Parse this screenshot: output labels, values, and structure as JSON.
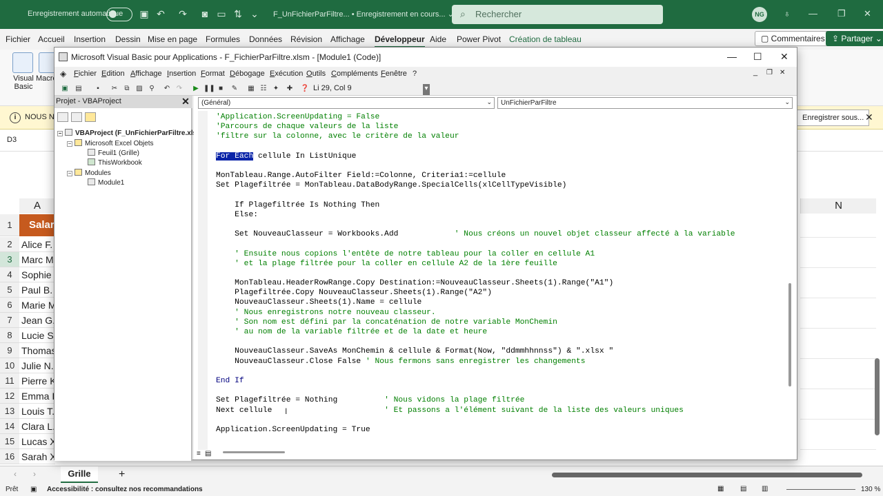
{
  "excel": {
    "autosave_label": "Enregistrement automatique",
    "doc_title": "F_UnFichierParFiltre... • Enregistrement en cours... ⌄",
    "search_placeholder": "Rechercher",
    "avatar_initials": "NG",
    "tabs": [
      "Fichier",
      "Accueil",
      "Insertion",
      "Dessin",
      "Mise en page",
      "Formules",
      "Données",
      "Révision",
      "Affichage",
      "Développeur",
      "Aide",
      "Power Pivot",
      "Création de tableau"
    ],
    "comments_label": "Commentaires",
    "share_label": "Partager",
    "ribbon_visual_basic": "Visual\nBasic",
    "ribbon_macro": "Macro",
    "info_text": "NOUS NE",
    "info_button": "Enregistrer sous...",
    "namebox": "D3",
    "col_a": "A",
    "col_n": "N",
    "header_salary": "Salar",
    "rows": [
      {
        "num": "2",
        "a": "Alice F."
      },
      {
        "num": "3",
        "a": "Marc M"
      },
      {
        "num": "4",
        "a": "Sophie"
      },
      {
        "num": "5",
        "a": "Paul B."
      },
      {
        "num": "6",
        "a": "Marie M"
      },
      {
        "num": "7",
        "a": "Jean G."
      },
      {
        "num": "8",
        "a": "Lucie S."
      },
      {
        "num": "9",
        "a": "Thomas"
      },
      {
        "num": "10",
        "a": "Julie N."
      },
      {
        "num": "11",
        "a": "Pierre K"
      },
      {
        "num": "12",
        "a": "Emma I"
      },
      {
        "num": "13",
        "a": "Louis T."
      },
      {
        "num": "14",
        "a": "Clara L."
      },
      {
        "num": "15",
        "a": "Lucas X"
      },
      {
        "num": "16",
        "a": "Sarah X."
      }
    ],
    "sheet_tab": "Grille",
    "status_ready": "Prêt",
    "status_access": "Accessibilité : consultez nos recommandations",
    "zoom": "130 %"
  },
  "vbe": {
    "title": "Microsoft Visual Basic pour Applications - F_FichierParFiltre.xlsm - [Module1 (Code)]",
    "menu": [
      "Fichier",
      "Edition",
      "Affichage",
      "Insertion",
      "Format",
      "Débogage",
      "Exécution",
      "Outils",
      "Compléments",
      "Fenêtre",
      "?"
    ],
    "cursor_position": "Li 29, Col 9",
    "project_title": "Projet - VBAProject",
    "tree": {
      "root": "VBAProject (F_UnFichierParFiltre.xlsx)",
      "excel_objects": "Microsoft Excel Objets",
      "sheet1": "Feuil1 (Grille)",
      "thisworkbook": "ThisWorkbook",
      "modules": "Modules",
      "module1": "Module1"
    },
    "combo_left": "(Général)",
    "combo_right": "UnFichierParFiltre",
    "code": {
      "l1": "'Application.ScreenUpdating = False",
      "l2": "'Parcours de chaque valeurs de la liste",
      "l3": "'filtre sur la colonne, avec le critère de la valeur",
      "l4_kw": "For Each",
      "l4_rest": " cellule In ListUnique",
      "l5": "MonTableau.Range.AutoFilter Field:=Colonne, Criteria1:=cellule",
      "l6": "Set Plagefiltrée = MonTableau.DataBodyRange.SpecialCells(xlCellTypeVisible)",
      "l7": "    If Plagefiltrée Is Nothing Then",
      "l8": "    Else:",
      "l9_code": "    Set NouveauClasseur = Workbooks.Add            ",
      "l9_cm": "' Nous créons un nouvel objet classeur affecté à la variable",
      "l10": "    ' Ensuite nous copions l'entête de notre tableau pour la coller en cellule A1",
      "l11": "    ' et la plage filtrée pour la coller en cellule A2 de la 1ère feuille",
      "l12": "    MonTableau.HeaderRowRange.Copy Destination:=NouveauClasseur.Sheets(1).Range(\"A1\")",
      "l13": "    Plagefiltrée.Copy NouveauClasseur.Sheets(1).Range(\"A2\")",
      "l14": "    NouveauClasseur.Sheets(1).Name = cellule",
      "l15": "    ' Nous enregistrons notre nouveau classeur.",
      "l16": "    ' Son nom est défini par la concaténation de notre variable MonChemin",
      "l17": "    ' au nom de la variable filtrée et de la date et heure",
      "l18": "    NouveauClasseur.SaveAs MonChemin & cellule & Format(Now, \"ddmmhhnnss\") & \".xlsx \"",
      "l19_code": "    NouveauClasseur.Close False ",
      "l19_cm": "' Nous fermons sans enregistrer les changements",
      "l20": "End If",
      "l21_code": "Set Plagefiltrée = Nothing          ",
      "l21_cm": "' Nous vidons la plage filtrée",
      "l22_code": "Next cellule                        ",
      "l22_cm": "' Et passons a l'élément suivant de la liste des valeurs uniques",
      "l23": "Application.ScreenUpdating = True"
    }
  },
  "colors": {
    "excel_green": "#1f6b40",
    "vba_comment": "#007f00",
    "vba_keyword": "#00007f",
    "selection": "#0a24a8",
    "table_header": "#c65a1e"
  }
}
